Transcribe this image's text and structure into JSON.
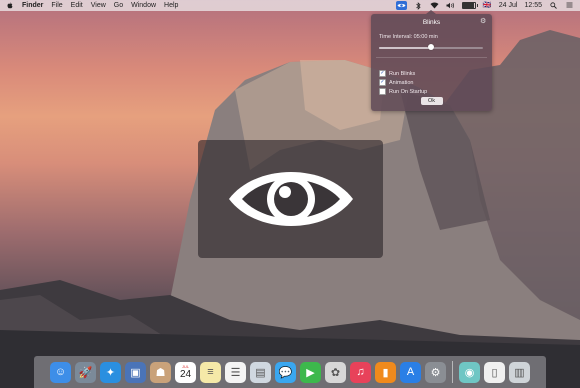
{
  "menubar": {
    "app_name": "Finder",
    "menus": [
      "File",
      "Edit",
      "View",
      "Go",
      "Window",
      "Help"
    ],
    "status": {
      "battery_level": 0.9,
      "flag_label": "🇬🇧",
      "date": "24 Jul",
      "time": "12:55"
    }
  },
  "popover": {
    "title": "Blinks",
    "interval_label": "Time Interval: 05:00 min",
    "slider_level": 0.5,
    "options": [
      {
        "label": "Run Blinks",
        "checked": true
      },
      {
        "label": "Animation",
        "checked": true
      },
      {
        "label": "Run On Startup",
        "checked": false
      }
    ],
    "ok_label": "Ok"
  },
  "dock": {
    "calendar_month": "JUL",
    "calendar_day": "24",
    "apps": [
      {
        "name": "finder",
        "icon": "finder-icon",
        "color": "#3d8ee8",
        "glyph": "☺"
      },
      {
        "name": "launchpad",
        "icon": "rocket-icon",
        "color": "#7b8a99",
        "glyph": "🚀"
      },
      {
        "name": "safari",
        "icon": "compass-icon",
        "color": "#2a8fe0",
        "glyph": "✦"
      },
      {
        "name": "photo",
        "icon": "photo-icon",
        "color": "#4a74b8",
        "glyph": "▣"
      },
      {
        "name": "contacts",
        "icon": "contacts-icon",
        "color": "#c9a27a",
        "glyph": "☗"
      },
      {
        "name": "calendar",
        "icon": "calendar-icon",
        "color": "#ffffff",
        "glyph": ""
      },
      {
        "name": "notes",
        "icon": "notes-icon",
        "color": "#f5e9a8",
        "glyph": "≡"
      },
      {
        "name": "reminders",
        "icon": "reminders-icon",
        "color": "#f4f4f4",
        "glyph": "☰"
      },
      {
        "name": "preview",
        "icon": "preview-icon",
        "color": "#d0d8e0",
        "glyph": "▤"
      },
      {
        "name": "messages",
        "icon": "messages-icon",
        "color": "#3aa7f0",
        "glyph": "💬"
      },
      {
        "name": "facetime",
        "icon": "facetime-icon",
        "color": "#3db84c",
        "glyph": "▶"
      },
      {
        "name": "photos",
        "icon": "photos-icon",
        "color": "#d7d7d7",
        "glyph": "✿"
      },
      {
        "name": "itunes",
        "icon": "music-icon",
        "color": "#e8425a",
        "glyph": "♫"
      },
      {
        "name": "ibooks",
        "icon": "book-icon",
        "color": "#f08a1c",
        "glyph": "▮"
      },
      {
        "name": "app-store",
        "icon": "app-store-icon",
        "color": "#2a7fe6",
        "glyph": "A"
      },
      {
        "name": "system-preferences",
        "icon": "gear-icon",
        "color": "#8a8e94",
        "glyph": "⚙"
      }
    ],
    "extras": [
      {
        "name": "blinks",
        "icon": "eye-icon",
        "color": "#6fc6c4",
        "glyph": "◉"
      },
      {
        "name": "document",
        "icon": "document-icon",
        "color": "#f0f0f0",
        "glyph": "▯"
      },
      {
        "name": "trash",
        "icon": "trash-icon",
        "color": "#cfd4d8",
        "glyph": "▥"
      }
    ]
  },
  "overlay": {
    "icon": "eye-icon"
  }
}
